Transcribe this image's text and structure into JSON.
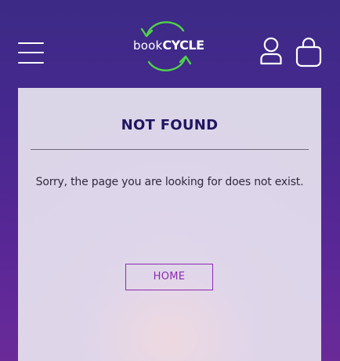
{
  "header": {
    "logo": {
      "book": "book",
      "cycle": "CYCLE",
      "arrow_color": "#4fd34a"
    },
    "menu_icon": "hamburger-menu-icon",
    "account_icon": "user-icon",
    "cart_icon": "shopping-bag-icon"
  },
  "main": {
    "title": "NOT FOUND",
    "message": "Sorry, the page you are looking for does not exist.",
    "home_button_label": "HOME"
  },
  "colors": {
    "title": "#1f1560",
    "button_accent": "#8a2bb0",
    "background_top": "#3c2a86",
    "background_bottom": "#6a2a98"
  }
}
